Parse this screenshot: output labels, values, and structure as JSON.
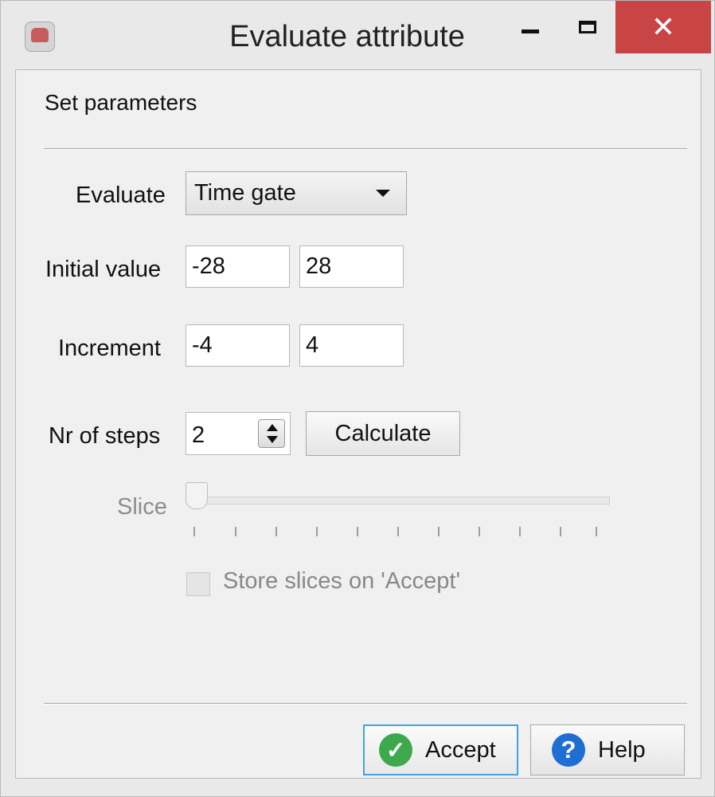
{
  "window": {
    "title": "Evaluate attribute",
    "minimize_symbol": "",
    "maximize_symbol": "",
    "close_symbol": "✕"
  },
  "form": {
    "section_title": "Set parameters",
    "evaluate_label": "Evaluate",
    "evaluate_value": "Time gate",
    "initial_value_label": "Initial value",
    "initial_values": [
      "-28",
      "28"
    ],
    "increment_label": "Increment",
    "increment_values": [
      "-4",
      "4"
    ],
    "nr_steps_label": "Nr of steps",
    "nr_steps_value": "2",
    "calculate_label": "Calculate",
    "slice_label": "Slice",
    "store_slices_label": "Store slices on 'Accept'",
    "store_slices_checked": false
  },
  "actions": {
    "accept_label": "Accept",
    "help_label": "Help"
  },
  "icons": {
    "window_icon": "app-icon",
    "accept_icon": "check-icon",
    "help_icon": "help-icon",
    "dropdown_icon": "chevron-down-icon",
    "spinner_icon": "spinner-icon"
  },
  "colors": {
    "close_button": "#c94545",
    "accept_focus": "#40a3e3",
    "accept_icon": "#3ea94c",
    "help_icon": "#1f6ed1"
  }
}
